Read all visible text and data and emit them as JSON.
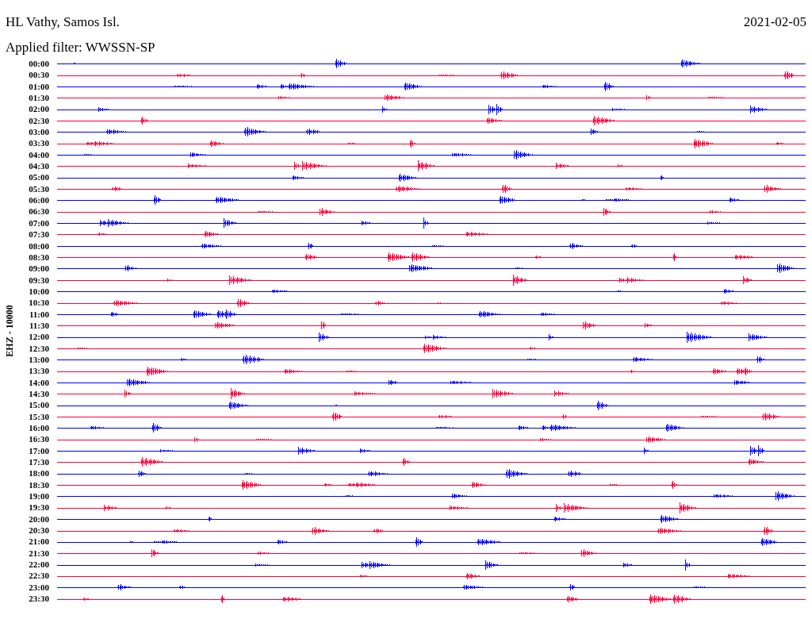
{
  "header": {
    "station": "HL Vathy, Samos Isl.",
    "date": "2021-02-05",
    "filter": "Applied filter: WWSSN-SP"
  },
  "axis_label": "EHZ - 10000",
  "rows": [
    {
      "time": "00:00",
      "color": "#0000ff"
    },
    {
      "time": "00:30",
      "color": "#ff0040"
    },
    {
      "time": "01:00",
      "color": "#0000ff"
    },
    {
      "time": "01:30",
      "color": "#ff0040"
    },
    {
      "time": "02:00",
      "color": "#0000ff"
    },
    {
      "time": "02:30",
      "color": "#ff0040"
    },
    {
      "time": "03:00",
      "color": "#0000ff"
    },
    {
      "time": "03:30",
      "color": "#ff0040"
    },
    {
      "time": "04:00",
      "color": "#0000ff"
    },
    {
      "time": "04:30",
      "color": "#ff0040"
    },
    {
      "time": "05:00",
      "color": "#0000ff"
    },
    {
      "time": "05:30",
      "color": "#ff0040"
    },
    {
      "time": "06:00",
      "color": "#0000ff"
    },
    {
      "time": "06:30",
      "color": "#ff0040"
    },
    {
      "time": "07:00",
      "color": "#0000ff"
    },
    {
      "time": "07:30",
      "color": "#ff0040"
    },
    {
      "time": "08:00",
      "color": "#0000ff"
    },
    {
      "time": "08:30",
      "color": "#ff0040"
    },
    {
      "time": "09:00",
      "color": "#0000ff"
    },
    {
      "time": "09:30",
      "color": "#ff0040"
    },
    {
      "time": "10:00",
      "color": "#0000ff"
    },
    {
      "time": "10:30",
      "color": "#ff0040"
    },
    {
      "time": "11:00",
      "color": "#0000ff"
    },
    {
      "time": "11:30",
      "color": "#ff0040"
    },
    {
      "time": "12:00",
      "color": "#0000ff"
    },
    {
      "time": "12:30",
      "color": "#ff0040"
    },
    {
      "time": "13:00",
      "color": "#0000ff"
    },
    {
      "time": "13:30",
      "color": "#ff0040"
    },
    {
      "time": "14:00",
      "color": "#0000ff"
    },
    {
      "time": "14:30",
      "color": "#ff0040"
    },
    {
      "time": "15:00",
      "color": "#0000ff"
    },
    {
      "time": "15:30",
      "color": "#ff0040"
    },
    {
      "time": "16:00",
      "color": "#0000ff"
    },
    {
      "time": "16:30",
      "color": "#ff0040"
    },
    {
      "time": "17:00",
      "color": "#0000ff"
    },
    {
      "time": "17:30",
      "color": "#ff0040"
    },
    {
      "time": "18:00",
      "color": "#0000ff"
    },
    {
      "time": "18:30",
      "color": "#ff0040"
    },
    {
      "time": "19:00",
      "color": "#0000ff"
    },
    {
      "time": "19:30",
      "color": "#ff0040"
    },
    {
      "time": "20:00",
      "color": "#0000ff"
    },
    {
      "time": "20:30",
      "color": "#ff0040"
    },
    {
      "time": "21:00",
      "color": "#0000ff"
    },
    {
      "time": "21:30",
      "color": "#ff0040"
    },
    {
      "time": "22:00",
      "color": "#0000ff"
    },
    {
      "time": "22:30",
      "color": "#ff0040"
    },
    {
      "time": "23:00",
      "color": "#0000ff"
    },
    {
      "time": "23:30",
      "color": "#ff0040"
    }
  ]
}
